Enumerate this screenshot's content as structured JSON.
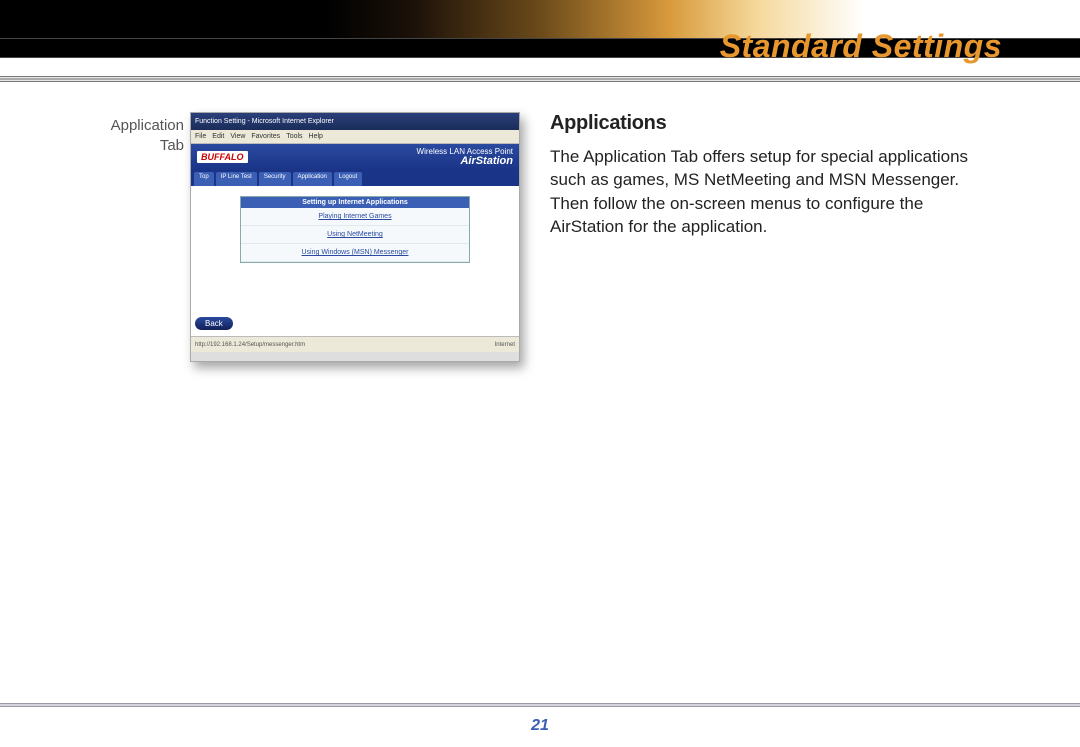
{
  "header": {
    "title": "Standard Settings"
  },
  "figure": {
    "label_line1": "Application",
    "label_line2": "Tab"
  },
  "screenshot": {
    "window_title": "Function Setting - Microsoft Internet Explorer",
    "menus": [
      "File",
      "Edit",
      "View",
      "Favorites",
      "Tools",
      "Help"
    ],
    "brand_left": "BUFFALO",
    "brand_right_small": "Wireless LAN Access Point",
    "brand_right_big": "AirStation",
    "tabs": [
      "Top",
      "IP Line Test",
      "Security",
      "Application",
      "Logout"
    ],
    "panel_header": "Setting up Internet Applications",
    "panel_links": [
      "Playing Internet Games",
      "Using NetMeeting",
      "Using Windows (MSN) Messenger"
    ],
    "back_button": "Back",
    "status_left": "http://192.168.1.24/Setup/messenger.htm",
    "status_right": "Internet"
  },
  "article": {
    "heading": "Applications",
    "body": "The Application Tab offers setup for special ap­plications such as games, MS NetMeeting and MSN Messenger.  Then follow the on-screen menus to configure the AirStation for the applica­tion."
  },
  "page_number": "21"
}
